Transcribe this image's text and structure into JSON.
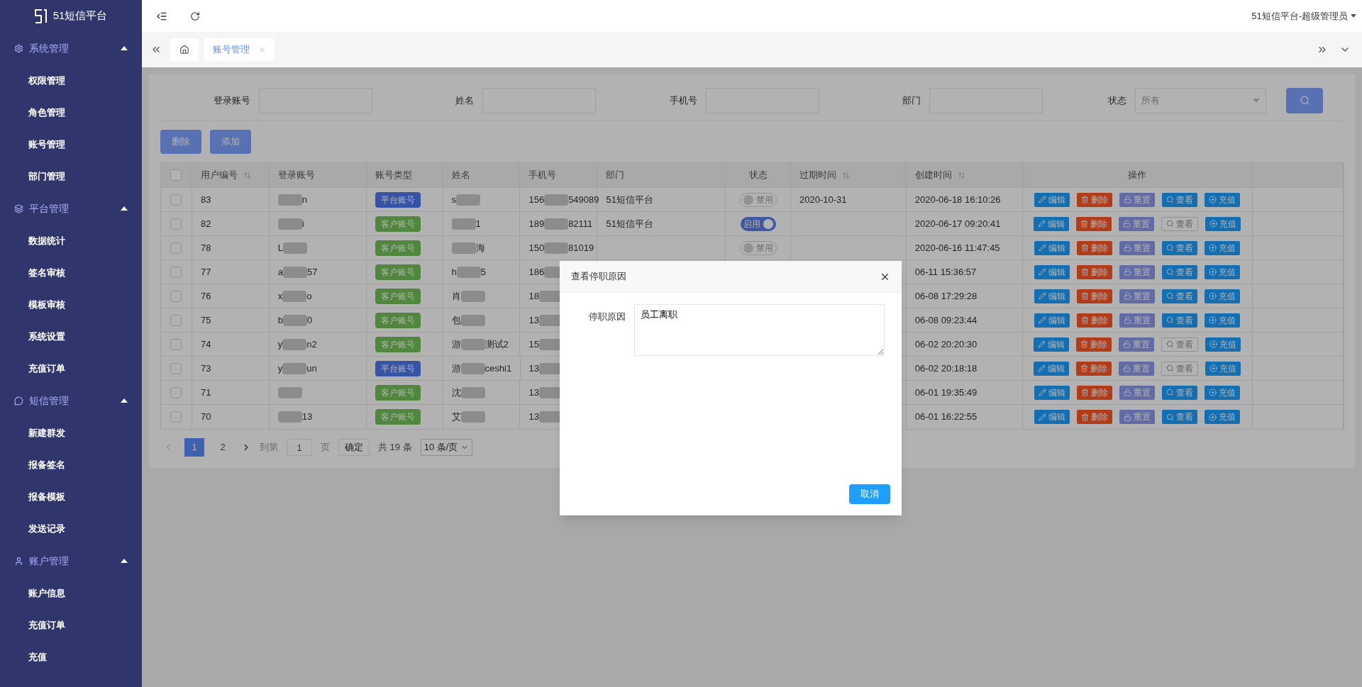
{
  "sidebar": {
    "brand": "51短信平台",
    "sections": [
      {
        "title": "系统管理",
        "expanded": true,
        "items": [
          "权限管理",
          "角色管理",
          "账号管理",
          "部门管理"
        ]
      },
      {
        "title": "平台管理",
        "expanded": true,
        "items": [
          "数据统计",
          "签名审核",
          "模板审核",
          "系统设置",
          "充值订单"
        ]
      },
      {
        "title": "短信管理",
        "expanded": true,
        "items": [
          "新建群发",
          "报备签名",
          "报备模板",
          "发送记录"
        ]
      },
      {
        "title": "账户管理",
        "expanded": true,
        "items": [
          "账户信息",
          "充值订单",
          "充值"
        ]
      }
    ]
  },
  "header": {
    "user": "51短信平台-超级管理员"
  },
  "tabs": [
    {
      "label": "账号管理",
      "selected": true
    }
  ],
  "filters": {
    "fields": [
      {
        "label": "登录账号",
        "kind": "input"
      },
      {
        "label": "姓名",
        "kind": "input"
      },
      {
        "label": "手机号",
        "kind": "input"
      },
      {
        "label": "部门",
        "kind": "input"
      },
      {
        "label": "状态",
        "kind": "select",
        "placeholder": "所有"
      }
    ]
  },
  "toolbar": [
    "删除",
    "添加"
  ],
  "table": {
    "select_all_checked": false,
    "columns": [
      {
        "label": "用户编号",
        "sortable": true
      },
      {
        "label": "登录账号",
        "sortable": false
      },
      {
        "label": "账号类型",
        "sortable": false
      },
      {
        "label": "姓名",
        "sortable": false
      },
      {
        "label": "手机号",
        "sortable": false
      },
      {
        "label": "部门",
        "sortable": false
      },
      {
        "label": "状态",
        "sortable": false
      },
      {
        "label": "过期时间",
        "sortable": true
      },
      {
        "label": "创建时间",
        "sortable": true
      },
      {
        "label": "操作",
        "sortable": false
      }
    ],
    "rows": [
      {
        "id": "83",
        "checked": false,
        "login": [
          {
            "kind": "blur"
          },
          "n"
        ],
        "type": {
          "label": "平台账号",
          "kind": "platform"
        },
        "name": [
          "s",
          {
            "kind": "blur"
          }
        ],
        "phone": [
          "156",
          {
            "kind": "blur"
          },
          "549089"
        ],
        "dept": "51短信平台",
        "status": {
          "label": "禁用",
          "on": false
        },
        "expire": "2020-10-31",
        "created": "2020-06-18 16:10:26",
        "actions": [
          {
            "label": "编辑",
            "kind": "edit",
            "disabled": false
          },
          {
            "label": "删除",
            "kind": "delete",
            "disabled": false
          },
          {
            "label": "重置",
            "kind": "reset",
            "disabled": false
          },
          {
            "label": "查看",
            "kind": "view",
            "disabled": false
          },
          {
            "label": "充值",
            "kind": "recharge",
            "disabled": false
          }
        ]
      },
      {
        "id": "82",
        "checked": false,
        "login": [
          {
            "kind": "blur"
          },
          "i"
        ],
        "type": {
          "label": "客户账号",
          "kind": "customer"
        },
        "name": [
          {
            "kind": "blur"
          },
          "1"
        ],
        "phone": [
          "189",
          {
            "kind": "blur"
          },
          "82111"
        ],
        "dept": "51短信平台",
        "status": {
          "label": "启用",
          "on": true
        },
        "created": "2020-06-17 09:20:41",
        "actions": [
          {
            "label": "编辑",
            "kind": "edit",
            "disabled": false
          },
          {
            "label": "删除",
            "kind": "delete",
            "disabled": false
          },
          {
            "label": "重置",
            "kind": "reset",
            "disabled": false
          },
          {
            "label": "查看",
            "kind": "view",
            "disabled": true
          },
          {
            "label": "充值",
            "kind": "recharge",
            "disabled": false
          }
        ]
      },
      {
        "id": "78",
        "checked": false,
        "login": [
          "L",
          {
            "kind": "blur"
          }
        ],
        "type": {
          "label": "客户账号",
          "kind": "customer"
        },
        "name": [
          {
            "kind": "blur"
          },
          "海"
        ],
        "phone": [
          "150",
          {
            "kind": "blur"
          },
          "81019"
        ],
        "status": {
          "label": "禁用",
          "on": false
        },
        "created": "2020-06-16 11:47:45",
        "actions": [
          {
            "label": "编辑",
            "kind": "edit",
            "disabled": false
          },
          {
            "label": "删除",
            "kind": "delete",
            "disabled": false
          },
          {
            "label": "重置",
            "kind": "reset",
            "disabled": false
          },
          {
            "label": "查看",
            "kind": "view",
            "disabled": false
          },
          {
            "label": "充值",
            "kind": "recharge",
            "disabled": false
          }
        ]
      },
      {
        "id": "77",
        "checked": false,
        "login": [
          "a",
          {
            "kind": "blur"
          },
          "57"
        ],
        "type": {
          "label": "客户账号",
          "kind": "customer"
        },
        "name": [
          "h",
          {
            "kind": "blur"
          },
          "5"
        ],
        "phone": [
          "186",
          {
            "kind": "blur"
          }
        ],
        "created": "06-11 15:36:57",
        "actions": [
          {
            "label": "编辑",
            "kind": "edit",
            "disabled": false
          },
          {
            "label": "删除",
            "kind": "delete",
            "disabled": false
          },
          {
            "label": "重置",
            "kind": "reset",
            "disabled": false
          },
          {
            "label": "查看",
            "kind": "view",
            "disabled": false
          },
          {
            "label": "充值",
            "kind": "recharge",
            "disabled": false
          }
        ]
      },
      {
        "id": "76",
        "checked": false,
        "login": [
          "x",
          {
            "kind": "blur"
          },
          "o"
        ],
        "type": {
          "label": "客户账号",
          "kind": "customer"
        },
        "name": [
          "肖",
          {
            "kind": "blur"
          }
        ],
        "phone": [
          "18",
          {
            "kind": "blur"
          }
        ],
        "created": "06-08 17:29:28",
        "actions": [
          {
            "label": "编辑",
            "kind": "edit",
            "disabled": false
          },
          {
            "label": "删除",
            "kind": "delete",
            "disabled": false
          },
          {
            "label": "重置",
            "kind": "reset",
            "disabled": false
          },
          {
            "label": "查看",
            "kind": "view",
            "disabled": false
          },
          {
            "label": "充值",
            "kind": "recharge",
            "disabled": false
          }
        ]
      },
      {
        "id": "75",
        "checked": false,
        "login": [
          "b",
          {
            "kind": "blur"
          },
          "0"
        ],
        "type": {
          "label": "客户账号",
          "kind": "customer"
        },
        "name": [
          "包",
          {
            "kind": "blur"
          }
        ],
        "phone": [
          "13",
          {
            "kind": "blur"
          }
        ],
        "created": "06-08 09:23:44",
        "actions": [
          {
            "label": "编辑",
            "kind": "edit",
            "disabled": false
          },
          {
            "label": "删除",
            "kind": "delete",
            "disabled": false
          },
          {
            "label": "重置",
            "kind": "reset",
            "disabled": false
          },
          {
            "label": "查看",
            "kind": "view",
            "disabled": false
          },
          {
            "label": "充值",
            "kind": "recharge",
            "disabled": false
          }
        ]
      },
      {
        "id": "74",
        "checked": false,
        "login": [
          "y",
          {
            "kind": "blur"
          },
          "n2"
        ],
        "type": {
          "label": "客户账号",
          "kind": "customer"
        },
        "name": [
          "游",
          {
            "kind": "blur"
          },
          "测试2"
        ],
        "phone": [
          "15",
          {
            "kind": "blur"
          }
        ],
        "created": "06-02 20:20:30",
        "actions": [
          {
            "label": "编辑",
            "kind": "edit",
            "disabled": false
          },
          {
            "label": "删除",
            "kind": "delete",
            "disabled": false
          },
          {
            "label": "重置",
            "kind": "reset",
            "disabled": false
          },
          {
            "label": "查看",
            "kind": "view",
            "disabled": true
          },
          {
            "label": "充值",
            "kind": "recharge",
            "disabled": false
          }
        ]
      },
      {
        "id": "73",
        "checked": false,
        "login": [
          "y",
          {
            "kind": "blur"
          },
          "un"
        ],
        "type": {
          "label": "平台账号",
          "kind": "platform"
        },
        "name": [
          "游",
          {
            "kind": "blur"
          },
          "ceshi1"
        ],
        "phone": [
          "13",
          {
            "kind": "blur"
          }
        ],
        "created": "06-02 20:18:18",
        "actions": [
          {
            "label": "编辑",
            "kind": "edit",
            "disabled": false
          },
          {
            "label": "删除",
            "kind": "delete",
            "disabled": false
          },
          {
            "label": "重置",
            "kind": "reset",
            "disabled": false
          },
          {
            "label": "查看",
            "kind": "view",
            "disabled": true
          },
          {
            "label": "充值",
            "kind": "recharge",
            "disabled": false
          }
        ]
      },
      {
        "id": "71",
        "checked": false,
        "login": [
          {
            "kind": "blur"
          }
        ],
        "type": {
          "label": "客户账号",
          "kind": "customer"
        },
        "name": [
          "沈",
          {
            "kind": "blur"
          }
        ],
        "phone": [
          "13",
          {
            "kind": "blur"
          }
        ],
        "created": "06-01 19:35:49",
        "actions": [
          {
            "label": "编辑",
            "kind": "edit",
            "disabled": false
          },
          {
            "label": "删除",
            "kind": "delete",
            "disabled": false
          },
          {
            "label": "重置",
            "kind": "reset",
            "disabled": false
          },
          {
            "label": "查看",
            "kind": "view",
            "disabled": false
          },
          {
            "label": "充值",
            "kind": "recharge",
            "disabled": false
          }
        ]
      },
      {
        "id": "70",
        "checked": false,
        "login": [
          {
            "kind": "blur"
          },
          "13"
        ],
        "type": {
          "label": "客户账号",
          "kind": "customer"
        },
        "name": [
          "艾",
          {
            "kind": "blur"
          }
        ],
        "phone": [
          "13",
          {
            "kind": "blur"
          }
        ],
        "created": "06-01 16:22:55",
        "actions": [
          {
            "label": "编辑",
            "kind": "edit",
            "disabled": false
          },
          {
            "label": "删除",
            "kind": "delete",
            "disabled": false
          },
          {
            "label": "重置",
            "kind": "reset",
            "disabled": false
          },
          {
            "label": "查看",
            "kind": "view",
            "disabled": false
          },
          {
            "label": "充值",
            "kind": "recharge",
            "disabled": false
          }
        ]
      }
    ]
  },
  "pagination": {
    "pages": [
      {
        "label": "1",
        "selected": true
      },
      {
        "label": "2",
        "selected": false
      }
    ],
    "goto_label": "到第",
    "goto_value": "1",
    "page_unit": "页",
    "confirm": "确定",
    "total": "共 19 条",
    "page_size": "10 条/页"
  },
  "dialog": {
    "title": "查看停职原因",
    "field_label": "停职原因",
    "field_value": "员工离职",
    "cancel": "取消"
  }
}
